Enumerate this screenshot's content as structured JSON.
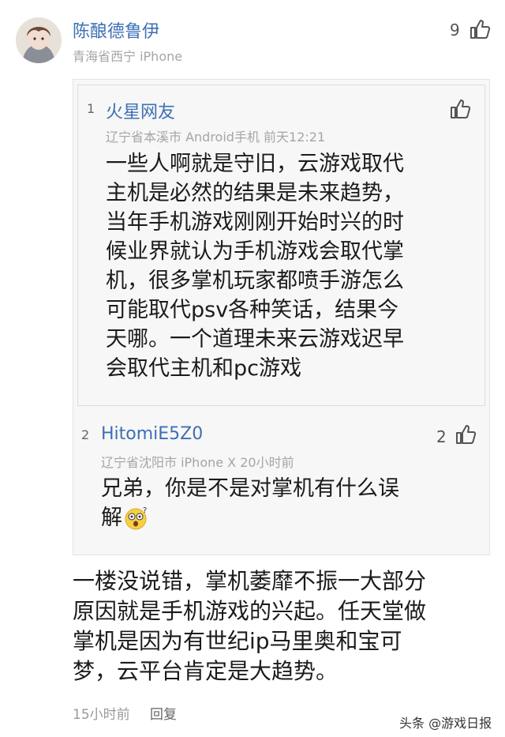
{
  "comment": {
    "username": "陈酿德鲁伊",
    "meta": "青海省西宁  iPhone",
    "likes": "9",
    "text": "一楼没说错，掌机萎靡不振一大部分原因就是手机游戏的兴起。任天堂做掌机是因为有世纪ip马里奥和宝可梦，云平台肯定是大趋势。",
    "text_lines": [
      "一楼没说错，掌机萎靡不振一大部分",
      "原因就是手机游戏的兴起。任天堂做",
      "掌机是因为有世纪ip马里奥和宝可",
      "梦，云平台肯定是大趋势。"
    ],
    "time": "15小时前",
    "reply_label": "回复"
  },
  "quotes": [
    {
      "floor": "1",
      "username": "火星网友",
      "meta": "辽宁省本溪市  Android手机  前天12:21",
      "text_lines": [
        "一些人啊就是守旧，云游戏取代",
        "主机是必然的结果是未来趋势，",
        "当年手机游戏刚刚开始时兴的时",
        "候业界就认为手机游戏会取代掌",
        "机，很多掌机玩家都喷手游怎么",
        "可能取代psv各种笑话，结果今",
        "天哪。一个道理未来云游戏迟早",
        "会取代主机和pc游戏"
      ]
    },
    {
      "floor": "2",
      "username": "HitomiE5Z0",
      "meta": "辽宁省沈阳市  iPhone X  20小时前",
      "likes": "2",
      "text_lines": [
        "兄弟，你是不是对掌机有什么误",
        "解"
      ]
    }
  ],
  "watermark": "头条 @游戏日报"
}
